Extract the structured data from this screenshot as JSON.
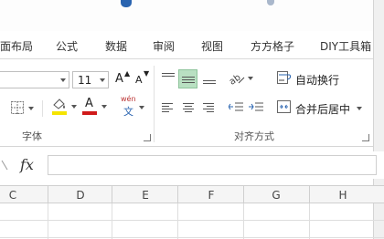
{
  "tabs": [
    "面布局",
    "公式",
    "数据",
    "审阅",
    "视图",
    "方方格子",
    "DIY工具箱"
  ],
  "font_group": {
    "font_size_value": "11",
    "grow_font_label": "A",
    "shrink_font_label": "A",
    "wen_label": "wén",
    "group_label": "字体"
  },
  "alignment_group": {
    "wrap_text_label": "自动换行",
    "merge_center_label": "合并后居中",
    "group_label": "对齐方式"
  },
  "formula_bar": {
    "fx_label": "fx"
  },
  "column_headers": [
    "C",
    "D",
    "E",
    "F",
    "G",
    "H"
  ],
  "colors": {
    "fill_color": "#f5e400",
    "font_color": "#d01a1a",
    "selected_bg": "#b9e0c2",
    "title_accent": "#2a64b0"
  }
}
